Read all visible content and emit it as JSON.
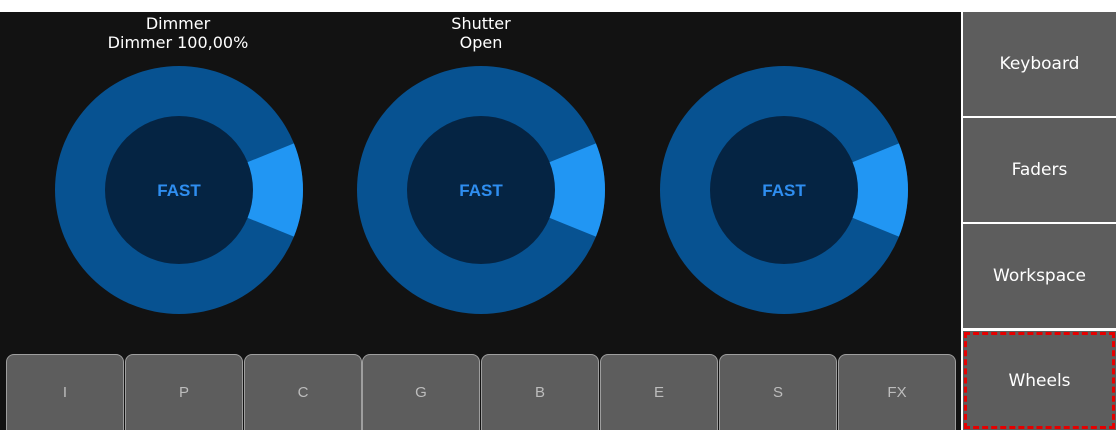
{
  "wheels": [
    {
      "title_line1": "Dimmer",
      "title_line2": "Dimmer 100,00%",
      "center_label": "FAST"
    },
    {
      "title_line1": "Shutter",
      "title_line2": "Open",
      "center_label": "FAST"
    },
    {
      "title_line1": "",
      "title_line2": "",
      "center_label": "FAST"
    }
  ],
  "colors": {
    "wheel_ring": "#075291",
    "wheel_center": "#052443",
    "wheel_indicator": "#2196f3",
    "label": "#2f8ef0",
    "highlight": "#e60000"
  },
  "group_tabs": [
    "I",
    "P",
    "C",
    "G",
    "B",
    "E",
    "S",
    "FX"
  ],
  "side_menu": {
    "items": [
      "Keyboard",
      "Faders",
      "Workspace",
      "Wheels"
    ],
    "highlighted": "Wheels"
  }
}
